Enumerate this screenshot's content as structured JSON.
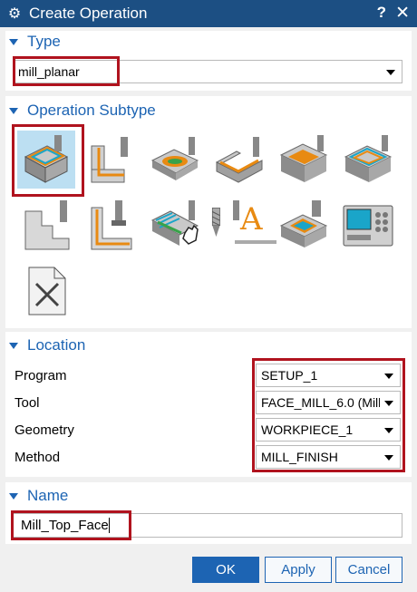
{
  "window": {
    "title": "Create Operation",
    "help_label": "?",
    "close_label": "✕",
    "gear_label": "⚙"
  },
  "type_section": {
    "title": "Type",
    "value": "mill_planar"
  },
  "subtype_section": {
    "title": "Operation Subtype",
    "icons": [
      "face-milling-area-icon",
      "planar-profile-icon",
      "floor-wall-icon",
      "floor-wall-is-icon",
      "face-milling-icon",
      "face-milling-manual-icon",
      "planar-mill-icon",
      "planar-profile-alt-icon",
      "cleanup-corners-icon",
      "finish-walls-icon",
      "planar-text-icon",
      "hole-chamfer-icon",
      "machine-control-icon",
      "user-defined-icon"
    ]
  },
  "location_section": {
    "title": "Location",
    "fields": [
      {
        "label": "Program",
        "value": "SETUP_1"
      },
      {
        "label": "Tool",
        "value": "FACE_MILL_6.0 (Milli"
      },
      {
        "label": "Geometry",
        "value": "WORKPIECE_1"
      },
      {
        "label": "Method",
        "value": "MILL_FINISH"
      }
    ]
  },
  "name_section": {
    "title": "Name",
    "value": "Mill_Top_Face"
  },
  "buttons": {
    "ok": "OK",
    "apply": "Apply",
    "cancel": "Cancel"
  },
  "colors": {
    "titlebar": "#1c4f83",
    "accent": "#1d64b3",
    "highlight": "#b0131e",
    "selected": "#bcdff2"
  }
}
